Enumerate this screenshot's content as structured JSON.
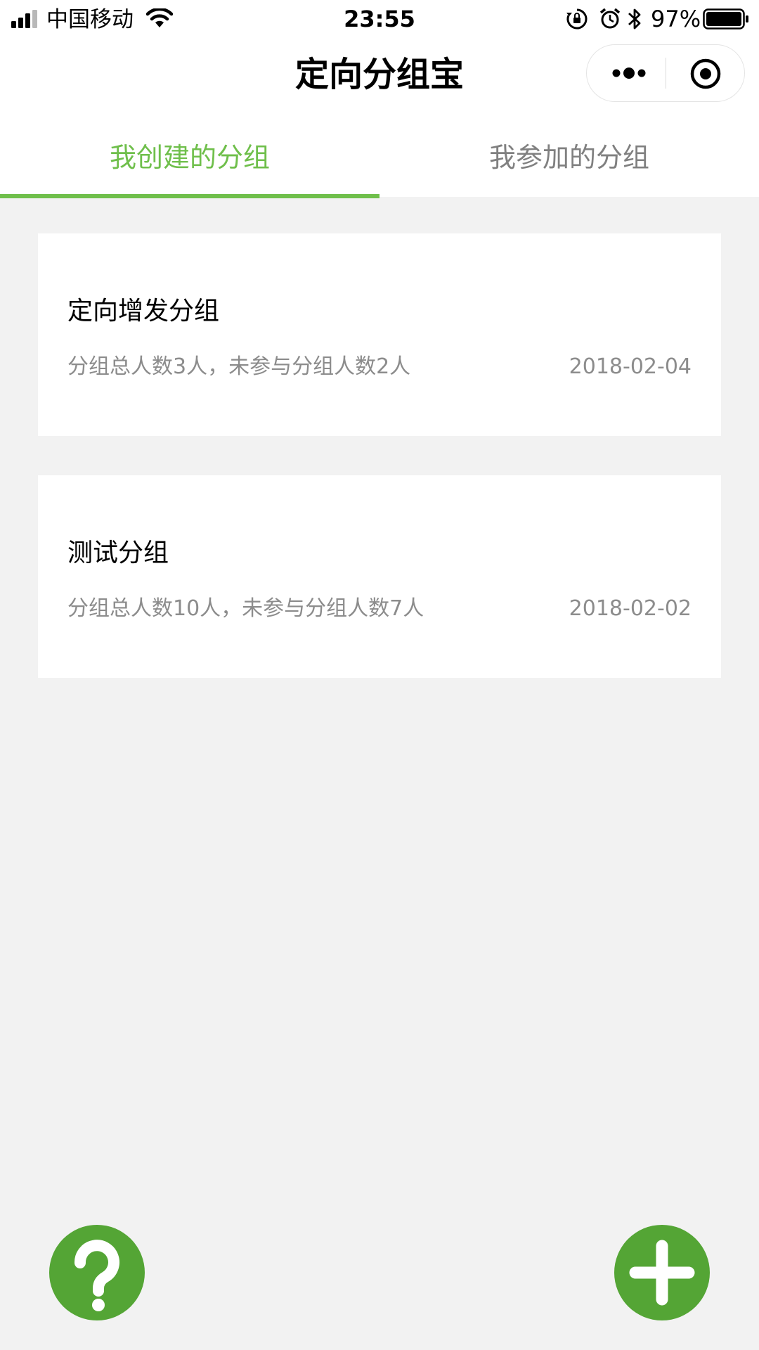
{
  "status_bar": {
    "carrier": "中国移动",
    "time": "23:55",
    "battery": "97%",
    "icons": [
      "signal-icon",
      "wifi-icon",
      "rotation-lock-icon",
      "alarm-icon",
      "bluetooth-icon",
      "battery-icon"
    ]
  },
  "nav": {
    "title": "定向分组宝",
    "icons": [
      "more-icon",
      "close-miniprogram-icon"
    ]
  },
  "tabs": {
    "items": [
      {
        "label": "我创建的分组",
        "active": true
      },
      {
        "label": "我参加的分组",
        "active": false
      }
    ]
  },
  "groups": [
    {
      "name": "定向增发分组",
      "summary": "分组总人数3人，未参与分组人数2人",
      "date": "2018-02-04"
    },
    {
      "name": "测试分组",
      "summary": "分组总人数10人，未参与分组人数7人",
      "date": "2018-02-02"
    }
  ],
  "fabs": {
    "help_icon": "question-icon",
    "add_icon": "plus-icon"
  },
  "colors": {
    "accent": "#6fbf4b",
    "fab": "#54a535",
    "background": "#f2f2f2"
  }
}
